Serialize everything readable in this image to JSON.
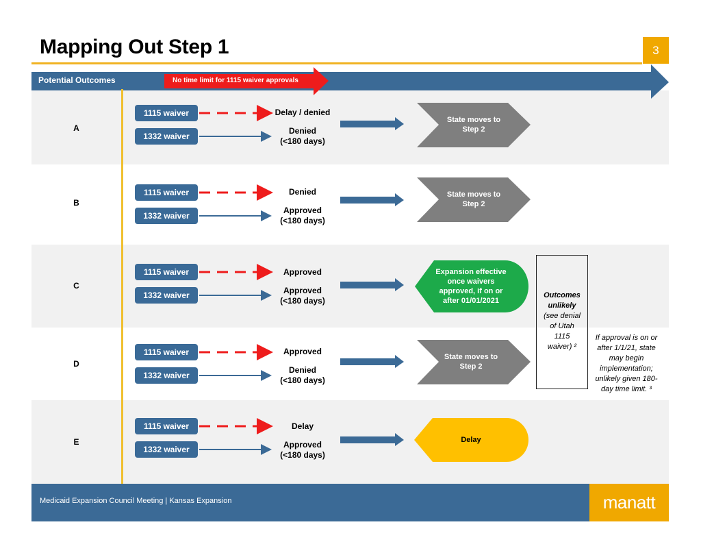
{
  "header": {
    "title": "Mapping Out Step 1",
    "page_number": "3",
    "bar_label": "Potential Outcomes",
    "callout": "No time limit for 1115 waiver approvals"
  },
  "colors": {
    "blue": "#3b6a96",
    "red": "#ee1c1c",
    "gold": "#f0a800",
    "gray_shape": "#7f7f7f",
    "green": "#1daa4a",
    "yellow": "#ffc000"
  },
  "rows": [
    {
      "label": "A",
      "w1115": "1115 waiver",
      "w1332": "1332 waiver",
      "out1115": "Delay / denied",
      "out1332_l1": "Denied",
      "out1332_l2": "(<180 days)",
      "result": [
        "State moves to",
        "Step 2"
      ],
      "result_type": "gray"
    },
    {
      "label": "B",
      "w1115": "1115 waiver",
      "w1332": "1332 waiver",
      "out1115": "Denied",
      "out1332_l1": "Approved",
      "out1332_l2": "(<180 days)",
      "result": [
        "State moves to",
        "Step 2"
      ],
      "result_type": "gray"
    },
    {
      "label": "C",
      "w1115": "1115 waiver",
      "w1332": "1332 waiver",
      "out1115": "Approved",
      "out1332_l1": "Approved",
      "out1332_l2": "(<180 days)",
      "result": [
        "Expansion effective",
        "once waivers",
        "approved, if on or",
        "after 01/01/2021"
      ],
      "result_type": "green"
    },
    {
      "label": "D",
      "w1115": "1115 waiver",
      "w1332": "1332 waiver",
      "out1115": "Approved",
      "out1332_l1": "Denied",
      "out1332_l2": "(<180 days)",
      "result": [
        "State moves to",
        "Step 2"
      ],
      "result_type": "gray"
    },
    {
      "label": "E",
      "w1115": "1115 waiver",
      "w1332": "1332 waiver",
      "out1115": "Delay",
      "out1332_l1": "Approved",
      "out1332_l2": "(<180 days)",
      "result": [
        "Delay"
      ],
      "result_type": "yellow"
    }
  ],
  "note_box": {
    "lines_bold": [
      "Outcomes",
      "unlikely"
    ],
    "lines": [
      "(see denial",
      "of Utah",
      "1115",
      "waiver) ²"
    ]
  },
  "side_note": [
    "If approval is on or",
    "after 1/1/21, state",
    "may begin",
    "implementation;",
    "unlikely given 180-",
    "day time limit. ³"
  ],
  "footer": {
    "text": "Medicaid Expansion Council Meeting | Kansas Expansion",
    "logo": "manatt"
  }
}
